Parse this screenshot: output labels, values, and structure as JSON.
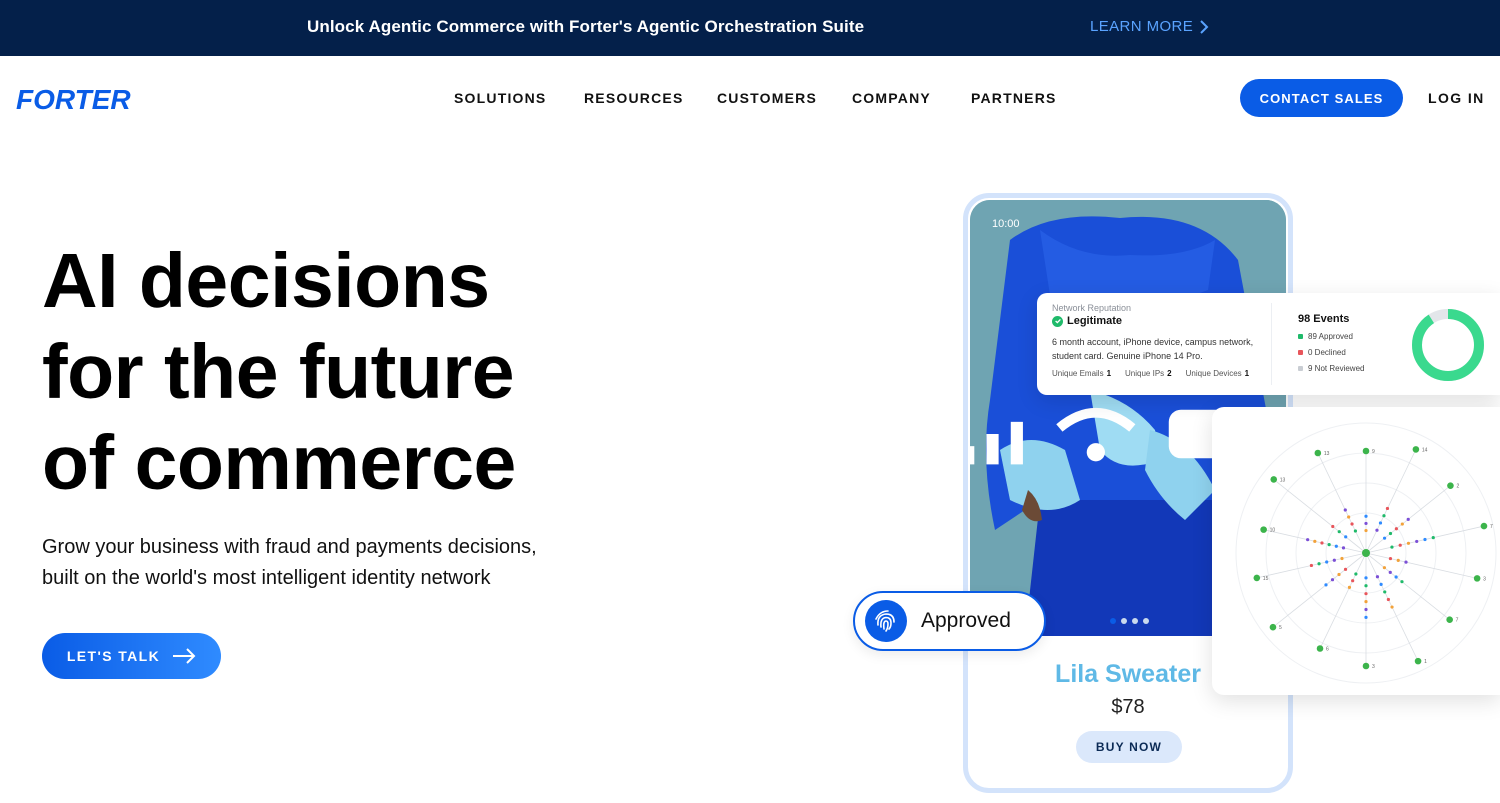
{
  "announcement": {
    "text": "Unlock Agentic Commerce with Forter's Agentic Orchestration Suite",
    "link_label": "LEARN MORE"
  },
  "header": {
    "logo_text": "FORTER",
    "nav": [
      "SOLUTIONS",
      "RESOURCES",
      "CUSTOMERS",
      "COMPANY",
      "PARTNERS"
    ],
    "contact_label": "CONTACT SALES",
    "login_label": "LOG IN"
  },
  "hero": {
    "title_lines": [
      "AI decisions",
      "for the future",
      "of commerce"
    ],
    "subtitle_lines": [
      "Grow your business with fraud and payments decisions,",
      "built on the world's most intelligent identity network"
    ],
    "cta_label": "LET'S TALK"
  },
  "phone": {
    "time": "10:00",
    "product_name": "Lila Sweater",
    "price": "$78",
    "buy_label": "BUY NOW"
  },
  "reputation": {
    "kicker": "Network Reputation",
    "status": "Legitimate",
    "description": "6 month account, iPhone device, campus network, student card. Genuine iPhone 14 Pro.",
    "stats": [
      {
        "label": "Unique Emails",
        "value": "1"
      },
      {
        "label": "Unique IPs",
        "value": "2"
      },
      {
        "label": "Unique Devices",
        "value": "1"
      }
    ],
    "events_title": "98 Events",
    "events": [
      {
        "label": "89 Approved",
        "color": "#1fba6a"
      },
      {
        "label": "0 Declined",
        "color": "#e8555b"
      },
      {
        "label": "9 Not Reviewed",
        "color": "#c9cdd3"
      }
    ],
    "approved_fraction": 0.908
  },
  "radar": {
    "node_labels": [
      "9",
      "14",
      "2",
      "7",
      "3",
      "7",
      "1",
      "3",
      "6",
      "5",
      "15",
      "10",
      "13",
      "13"
    ]
  },
  "approved_badge": {
    "label": "Approved"
  },
  "colors": {
    "brand_blue": "#0a5ce6",
    "announcement_bg": "#04204a",
    "link_blue": "#5aa3ff",
    "approved_green": "#1fba6a"
  }
}
